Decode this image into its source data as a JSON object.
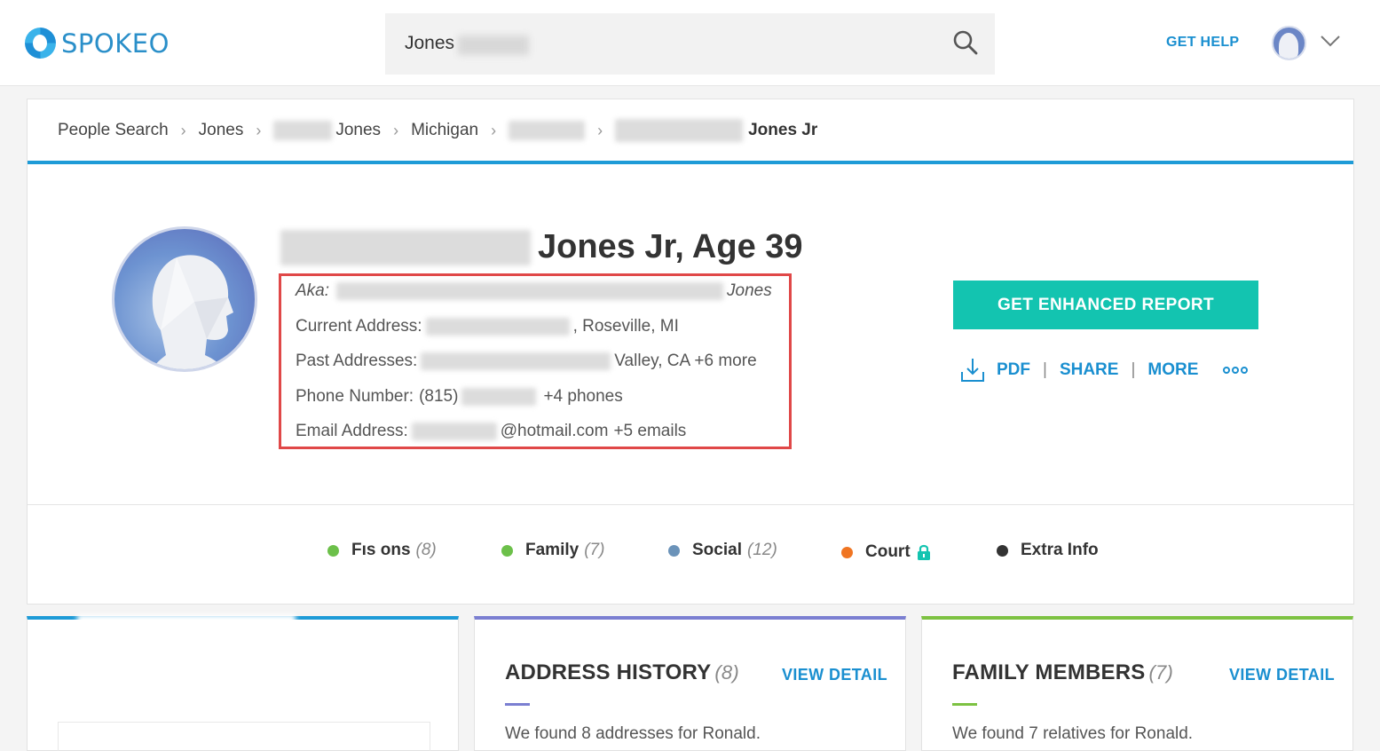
{
  "header": {
    "logo_text": "SPOKEO",
    "search_value": "Jones",
    "get_help": "GET HELP"
  },
  "breadcrumb": {
    "items": [
      "People Search",
      "Jones",
      "Jones",
      "Michigan",
      "Jones Jr"
    ]
  },
  "profile": {
    "name_suffix": "Jones Jr, Age 39",
    "aka_label": "Aka:",
    "aka_value": "Jones",
    "current_address_label": "Current Address:",
    "current_address_value": ", Roseville, MI",
    "past_addresses_label": "Past Addresses:",
    "past_addresses_value": "Valley, CA +6 more",
    "phone_label": "Phone Number:",
    "phone_prefix": "(815)",
    "phone_more": "+4 phones",
    "email_label": "Email Address:",
    "email_domain": "@hotmail.com",
    "email_more": "+5 emails"
  },
  "actions": {
    "enhanced_report": "GET ENHANCED REPORT",
    "pdf": "PDF",
    "share": "SHARE",
    "more": "MORE",
    "separator": "|"
  },
  "tabs": [
    {
      "label": "Fıs ons",
      "count": "(8)",
      "color": "#6cc04a"
    },
    {
      "label": "Family",
      "count": "(7)",
      "color": "#6cc04a"
    },
    {
      "label": "Social",
      "count": "(12)",
      "color": "#6b93b9"
    },
    {
      "label": "Court",
      "count": "",
      "color": "#f07522"
    },
    {
      "label": "Extra Info",
      "count": "",
      "color": "#333333"
    }
  ],
  "panels": {
    "address": {
      "title": "ADDRESS HISTORY",
      "count": "(8)",
      "link": "VIEW DETAIL",
      "text": "We found 8 addresses for Ronald.",
      "accent": "#7b7fd1"
    },
    "family": {
      "title": "FAMILY MEMBERS",
      "count": "(7)",
      "link": "VIEW DETAIL",
      "text": "We found 7 relatives for Ronald.",
      "accent": "#7dc242"
    }
  },
  "colors": {
    "brand_blue": "#1a8fd0",
    "teal_button": "#13c4b0",
    "highlight_red": "#e04848"
  }
}
